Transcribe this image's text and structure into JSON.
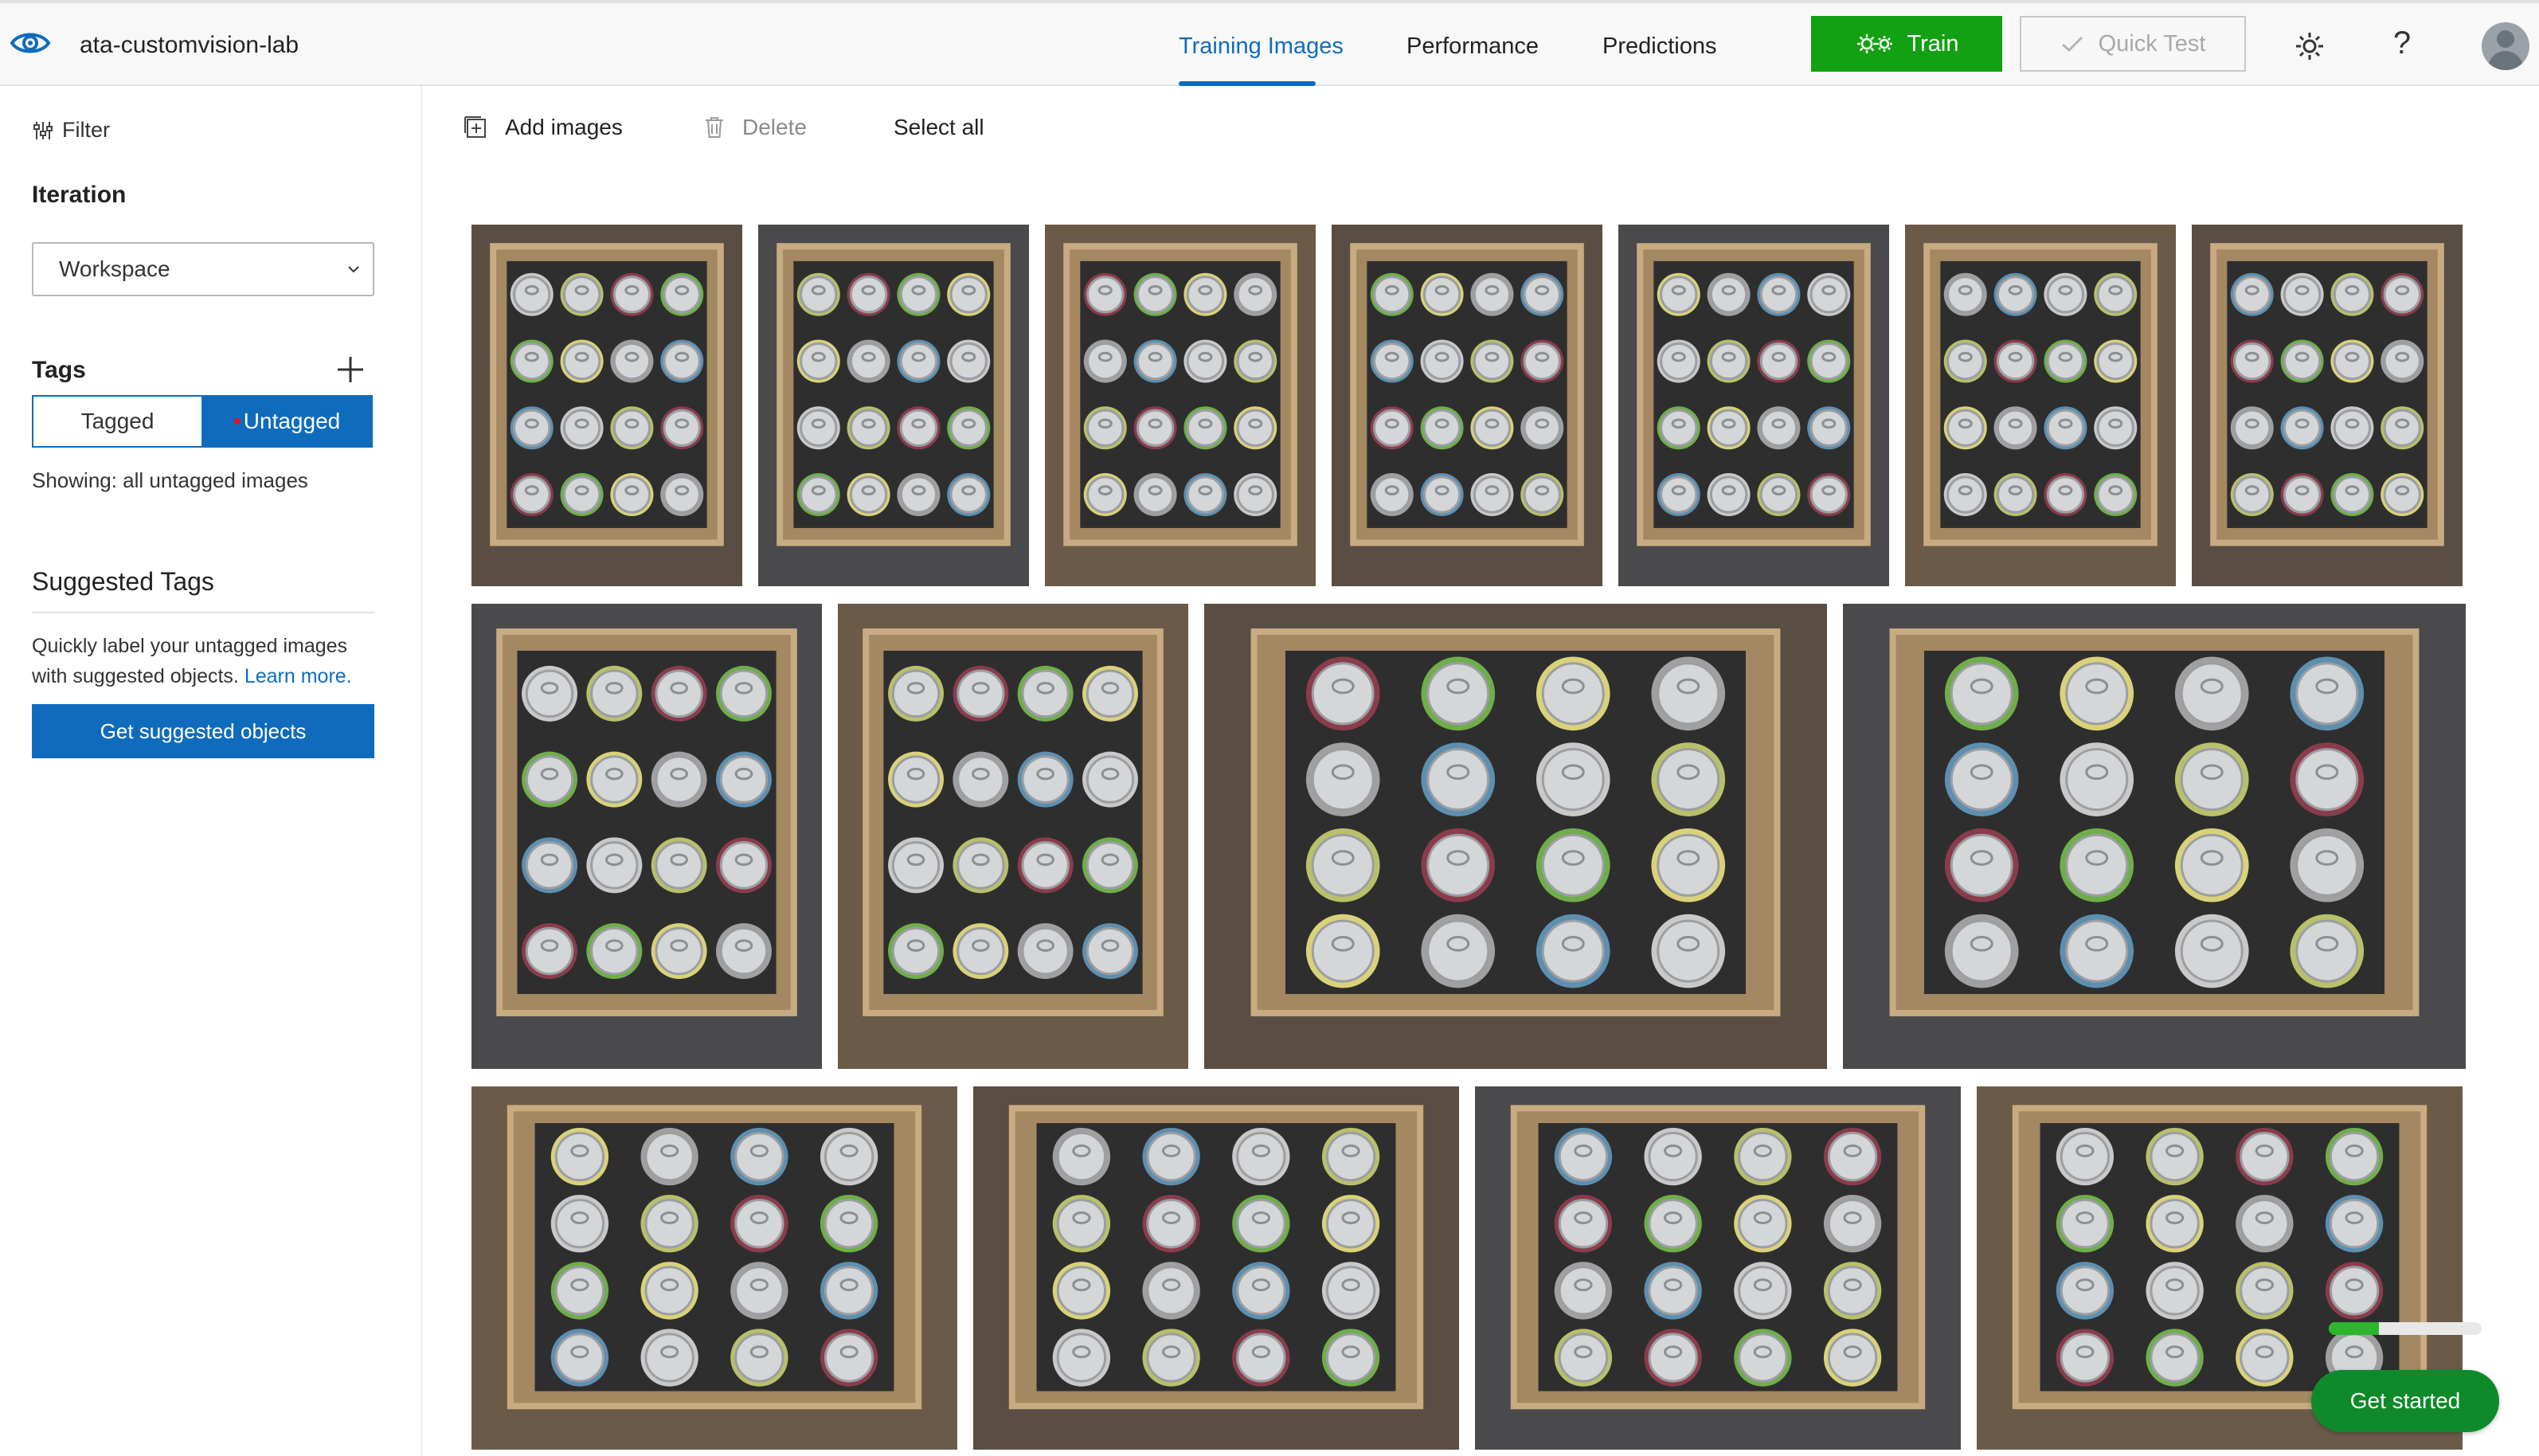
{
  "header": {
    "project_name": "ata-customvision-lab",
    "tabs": [
      {
        "label": "Training Images",
        "active": true
      },
      {
        "label": "Performance",
        "active": false
      },
      {
        "label": "Predictions",
        "active": false
      }
    ],
    "train_label": "Train",
    "quick_test_label": "Quick Test",
    "help_label": "?",
    "accent_color": "#0f6cbd",
    "train_color": "#12a112"
  },
  "sidebar": {
    "filter_label": "Filter",
    "iteration_label": "Iteration",
    "iteration_value": "Workspace",
    "tags_label": "Tags",
    "tagged_label": "Tagged",
    "untagged_label": "Untagged",
    "showing_text": "Showing: all untagged images",
    "suggested_title": "Suggested Tags",
    "suggested_text": "Quickly label your untagged images with suggested objects.",
    "learn_more": "Learn more.",
    "suggest_button": "Get suggested objects"
  },
  "toolbar": {
    "add_images": "Add images",
    "delete": "Delete",
    "select_all": "Select all"
  },
  "images": {
    "description": "Untagged training images of aluminum cans in cardboard boxes",
    "count": 15
  },
  "onboarding": {
    "get_started_label": "Get started",
    "progress_fraction": 0.33
  }
}
